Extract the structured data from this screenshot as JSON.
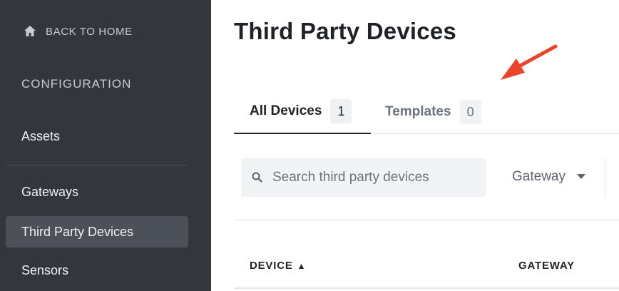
{
  "sidebar": {
    "back_label": "BACK TO HOME",
    "section_title": "CONFIGURATION",
    "items": [
      {
        "label": "Assets"
      },
      {
        "label": "Gateways"
      },
      {
        "label": "Third Party Devices"
      },
      {
        "label": "Sensors"
      }
    ],
    "active_item": "Third Party Devices"
  },
  "main": {
    "title": "Third Party Devices",
    "tabs": [
      {
        "label": "All Devices",
        "count": "1"
      },
      {
        "label": "Templates",
        "count": "0"
      }
    ],
    "search": {
      "placeholder": "Search third party devices",
      "value": ""
    },
    "gateway_filter": {
      "label": "Gateway"
    },
    "table": {
      "columns": [
        {
          "label": "DEVICE",
          "sort": "▲"
        },
        {
          "label": "GATEWAY"
        }
      ]
    }
  },
  "colors": {
    "sidebar_bg": "#33373d",
    "active_item_bg": "#4c5159",
    "annotation_arrow": "#e8452c"
  }
}
